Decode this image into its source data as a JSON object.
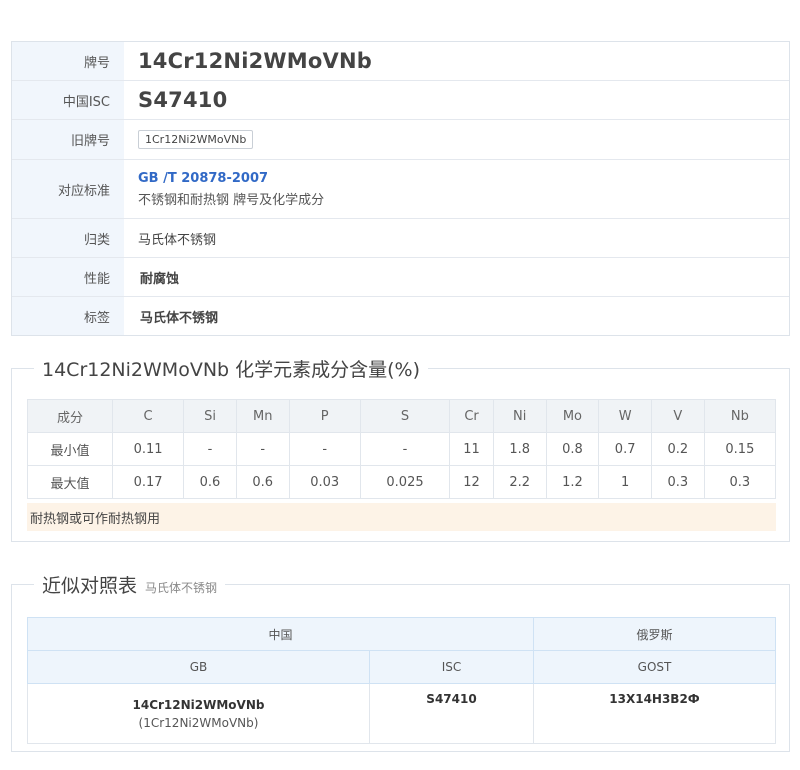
{
  "info": {
    "rows": [
      {
        "label": "牌号",
        "value": "14Cr12Ni2WMoVNb"
      },
      {
        "label": "中国ISC",
        "value": "S47410"
      },
      {
        "label": "旧牌号",
        "value": "1Cr12Ni2WMoVNb"
      },
      {
        "label": "对应标准",
        "link": "GB /T 20878-2007",
        "sub": "不锈钢和耐热钢 牌号及化学成分"
      },
      {
        "label": "归类",
        "value": "马氏体不锈钢"
      },
      {
        "label": "性能",
        "value": "耐腐蚀"
      },
      {
        "label": "标签",
        "value": "马氏体不锈钢"
      }
    ]
  },
  "composition": {
    "title": "14Cr12Ni2WMoVNb 化学元素成分含量(%)",
    "header": [
      "成分",
      "C",
      "Si",
      "Mn",
      "P",
      "S",
      "Cr",
      "Ni",
      "Mo",
      "W",
      "V",
      "Nb"
    ],
    "rows": [
      [
        "最小值",
        "0.11",
        "-",
        "-",
        "-",
        "-",
        "11",
        "1.8",
        "0.8",
        "0.7",
        "0.2",
        "0.15"
      ],
      [
        "最大值",
        "0.17",
        "0.6",
        "0.6",
        "0.03",
        "0.025",
        "12",
        "2.2",
        "1.2",
        "1",
        "0.3",
        "0.3"
      ]
    ],
    "note": "耐热钢或可作耐热钢用"
  },
  "comparison": {
    "title": "近似对照表",
    "subtitle": "马氏体不锈钢",
    "groups": [
      "中国",
      "俄罗斯"
    ],
    "columns": [
      "GB",
      "ISC",
      "GOST"
    ],
    "gb": "14Cr12Ni2WMoVNb",
    "gb_old": "(1Cr12Ni2WMoVNb)",
    "isc": "S47410",
    "gost": "13X14H3B2Ф"
  }
}
